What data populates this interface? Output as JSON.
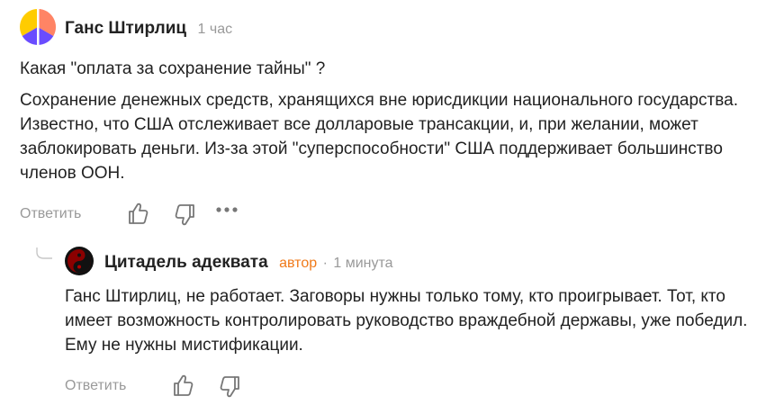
{
  "colors": {
    "badge_orange": "#f07a1a",
    "muted_gray": "#999999",
    "text": "#222222"
  },
  "comment": {
    "author": "Ганс Штирлиц",
    "time": "1 час",
    "paragraphs": [
      "Какая \"оплата за сохранение тайны\" ?",
      "Сохранение денежных средств, хранящихся вне юрисдикции национального государства. Известно, что США отслеживает все долларовые трансакции, и, при желании, может заблокировать деньги. Из-за этой \"суперспособности\" США поддерживает большинство членов ООН."
    ],
    "reply_label": "Ответить",
    "icons": [
      "like-icon",
      "dislike-icon",
      "more-icon"
    ]
  },
  "reply": {
    "author": "Цитадель адеквата",
    "badge": "автор",
    "separator": "·",
    "time": "1 минута",
    "text": "Ганс Штирлиц, не работает. Заговоры нужны только тому, кто проигрывает. Тот, кто имеет возможность контролировать руководство враждебной державы, уже победил. Ему не нужны мистификации.",
    "reply_label": "Ответить",
    "icons": [
      "like-icon",
      "dislike-icon"
    ]
  }
}
